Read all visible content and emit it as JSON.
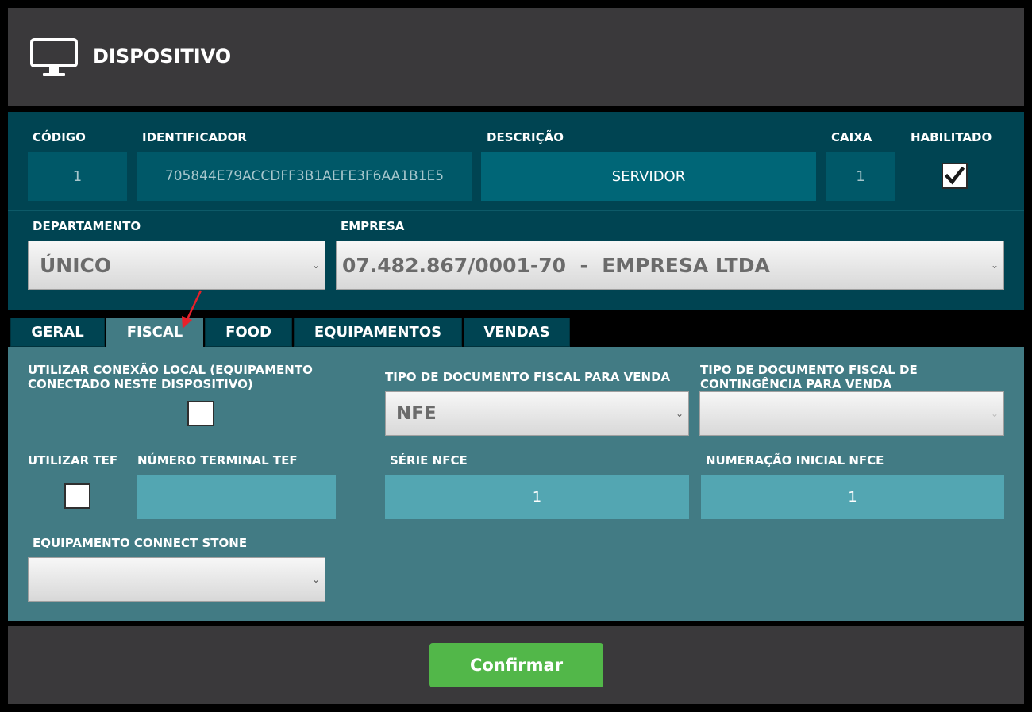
{
  "header": {
    "title": "DISPOSITIVO",
    "icon": "monitor-icon"
  },
  "device": {
    "codigo_label": "CÓDIGO",
    "codigo_value": "1",
    "identificador_label": "IDENTIFICADOR",
    "identificador_value": "705844E79ACCDFF3B1AEFE3F6AA1B1E5",
    "descricao_label": "DESCRIÇÃO",
    "descricao_value": "SERVIDOR",
    "caixa_label": "CAIXA",
    "caixa_value": "1",
    "habilitado_label": "HABILITADO",
    "habilitado_checked": true
  },
  "departamento": {
    "label": "DEPARTAMENTO",
    "value": "ÚNICO"
  },
  "empresa": {
    "label": "EMPRESA",
    "value": "07.482.867/0001-70  -  EMPRESA LTDA"
  },
  "tabs": [
    {
      "label": "GERAL",
      "active": false
    },
    {
      "label": "FISCAL",
      "active": true
    },
    {
      "label": "FOOD",
      "active": false
    },
    {
      "label": "EQUIPAMENTOS",
      "active": false
    },
    {
      "label": "VENDAS",
      "active": false
    }
  ],
  "fiscal": {
    "conexao_local_label_1": "UTILIZAR CONEXÃO LOCAL (EQUIPAMENTO",
    "conexao_local_label_2": "CONECTADO NESTE DISPOSITIVO)",
    "tipo_doc_label": "TIPO DE DOCUMENTO FISCAL PARA VENDA",
    "tipo_doc_value": "NFE",
    "tipo_doc_cont_label_1": "TIPO DE DOCUMENTO FISCAL DE",
    "tipo_doc_cont_label_2": "CONTINGÊNCIA PARA VENDA",
    "tipo_doc_cont_value": "",
    "utilizar_tef_label": "UTILIZAR TEF",
    "numero_terminal_label": "NÚMERO TERMINAL TEF",
    "numero_terminal_value": "",
    "serie_label": "SÉRIE NFCE",
    "serie_value": "1",
    "numeracao_label": "NUMERAÇÃO INICIAL NFCE",
    "numeracao_value": "1",
    "connect_stone_label": "EQUIPAMENTO CONNECT STONE",
    "connect_stone_value": ""
  },
  "footer": {
    "confirm_label": "Confirmar"
  },
  "colors": {
    "header_bg": "#3a393b",
    "top_bg": "#004452",
    "content_bg": "#427b84",
    "confirm": "#52b749",
    "arrow": "#e8202a"
  }
}
